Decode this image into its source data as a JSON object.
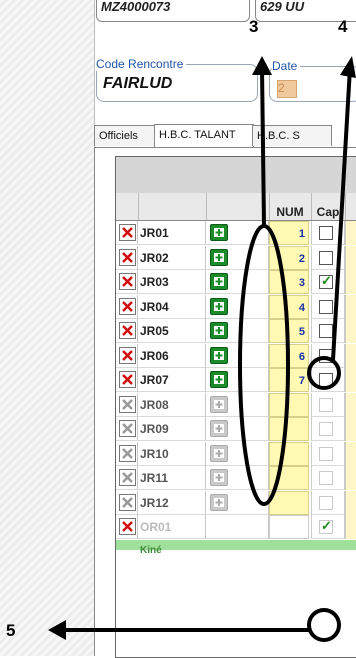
{
  "top_fields": {
    "left_value": "MZ4000073",
    "right_value": "629 UU"
  },
  "code_rencontre": {
    "legend": "Code Rencontre",
    "value": "FAIRLUD"
  },
  "date_field": {
    "legend": "Date",
    "value": "2"
  },
  "tabs": [
    {
      "label": "Officiels",
      "active": false
    },
    {
      "label": "H.B.C. TALANT",
      "active": true
    },
    {
      "label": "H.B.C. S",
      "active": false
    }
  ],
  "table": {
    "columns": {
      "num": "NUM",
      "cap": "Cap"
    },
    "rows": [
      {
        "code": "JR01",
        "num": "1",
        "cap": false,
        "active": true
      },
      {
        "code": "JR02",
        "num": "2",
        "cap": false,
        "active": true
      },
      {
        "code": "JR03",
        "num": "3",
        "cap": true,
        "active": true
      },
      {
        "code": "JR04",
        "num": "4",
        "cap": false,
        "active": true
      },
      {
        "code": "JR05",
        "num": "5",
        "cap": false,
        "active": true
      },
      {
        "code": "JR06",
        "num": "6",
        "cap": false,
        "active": true
      },
      {
        "code": "JR07",
        "num": "7",
        "cap": false,
        "active": true
      },
      {
        "code": "JR08",
        "num": "",
        "cap": false,
        "active": false
      },
      {
        "code": "JR09",
        "num": "",
        "cap": false,
        "active": false
      },
      {
        "code": "JR10",
        "num": "",
        "cap": false,
        "active": false
      },
      {
        "code": "JR11",
        "num": "",
        "cap": false,
        "active": false
      },
      {
        "code": "JR12",
        "num": "",
        "cap": false,
        "active": false
      },
      {
        "code": "OR01",
        "num": "",
        "cap": true,
        "active": true,
        "faded": true
      },
      {
        "code": "Kiné",
        "num": "",
        "cap": false,
        "active": true,
        "faded": true
      }
    ]
  },
  "annotations": {
    "label_3": "3",
    "label_4": "4",
    "label_5": "5"
  },
  "colors": {
    "delete_red": "#d01010",
    "add_green": "#1c8c2a",
    "num_fill": "#fff9b3",
    "accent_blue": "#1f56a6"
  }
}
